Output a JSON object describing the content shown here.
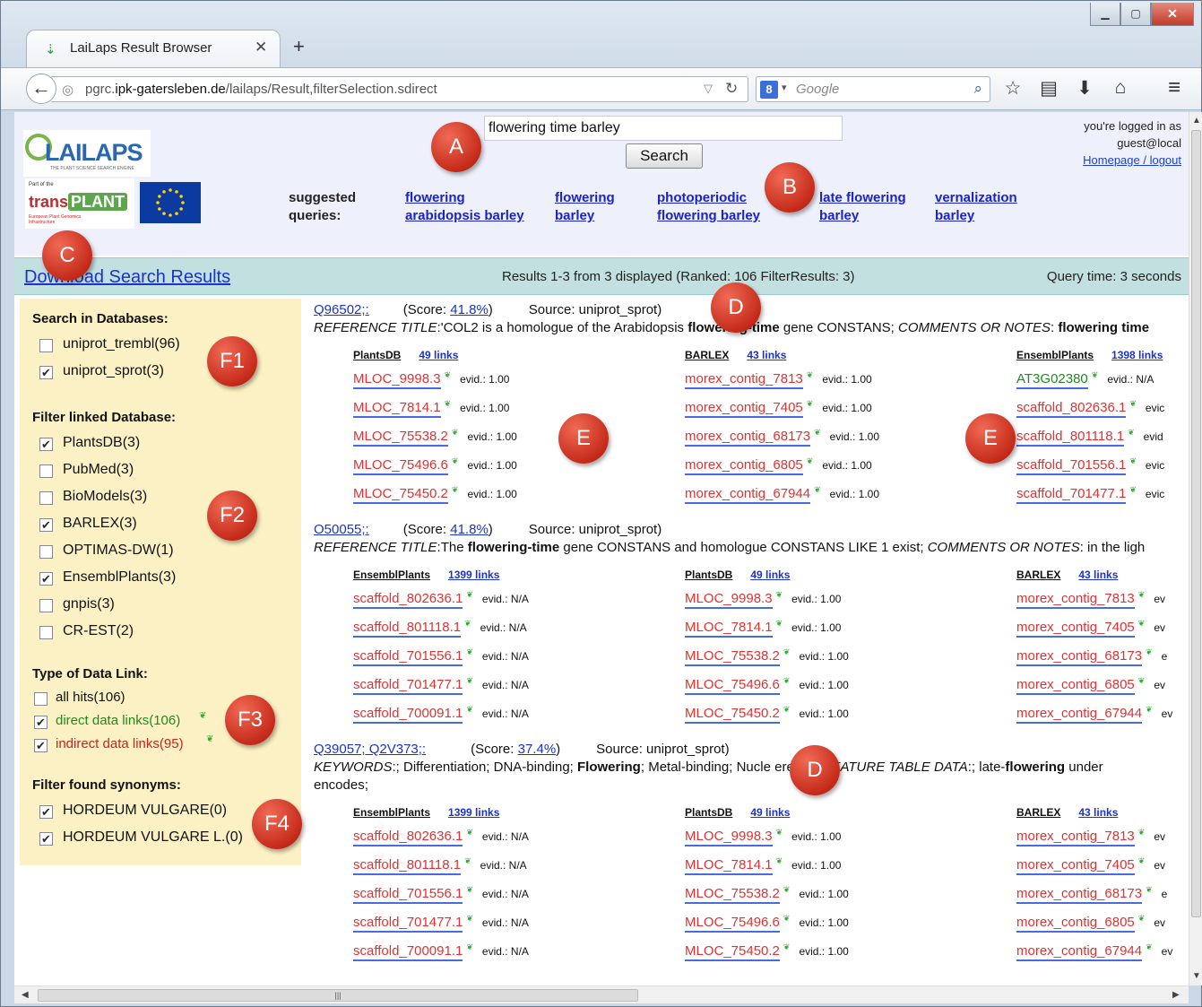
{
  "browser": {
    "tab_title": "LaiLaps Result Browser",
    "url_host_prefix": "pgrc.",
    "url_host": "ipk-gatersleben.de",
    "url_path": "/lailaps/Result,filterSelection.sdirect",
    "search_engine_placeholder": "Google"
  },
  "header": {
    "search_value": "flowering time barley",
    "search_button": "Search",
    "login_line1": "you're logged in as",
    "login_line2": "guest@local",
    "login_link": "Homepage / logout",
    "suggested_label_1": "suggested",
    "suggested_label_2": "queries:",
    "suggestions": [
      [
        "flowering",
        "arabidopsis barley"
      ],
      [
        "flowering",
        "barley"
      ],
      [
        "photoperiodic",
        "flowering barley"
      ],
      [
        "late flowering",
        "barley"
      ],
      [
        "vernalization",
        "barley"
      ]
    ]
  },
  "results_bar": {
    "download": "Download Search Results",
    "info": "Results 1-3 from 3 displayed (Ranked: 106 FilterResults: 3)",
    "query_time": "Query time: 3 seconds"
  },
  "filters": {
    "search_db_title": "Search in Databases:",
    "search_db": [
      {
        "label": "uniprot_trembl(96)",
        "checked": false
      },
      {
        "label": "uniprot_sprot(3)",
        "checked": true
      }
    ],
    "linked_db_title": "Filter linked Database:",
    "linked_db": [
      {
        "label": "PlantsDB(3)",
        "checked": true
      },
      {
        "label": "PubMed(3)",
        "checked": false
      },
      {
        "label": "BioModels(3)",
        "checked": false
      },
      {
        "label": "BARLEX(3)",
        "checked": true
      },
      {
        "label": "OPTIMAS-DW(1)",
        "checked": false
      },
      {
        "label": "EnsemblPlants(3)",
        "checked": true
      },
      {
        "label": "gnpis(3)",
        "checked": false
      },
      {
        "label": "CR-EST(2)",
        "checked": false
      }
    ],
    "link_type_title": "Type of Data Link:",
    "link_type": [
      {
        "label": "all hits(106)",
        "checked": false
      },
      {
        "label": "direct data links(106)",
        "checked": true
      },
      {
        "label": "indirect data links(95)",
        "checked": true
      }
    ],
    "synonyms_title": "Filter found synonyms:",
    "synonyms": [
      {
        "label": "HORDEUM VULGARE(0)",
        "checked": true
      },
      {
        "label": "HORDEUM VULGARE L.(0)",
        "checked": true
      }
    ]
  },
  "results": [
    {
      "id": "Q96502;:",
      "score_label": "(Score:",
      "score": "41.8%",
      "score_close": ")",
      "source": "Source: uniprot_sprot)",
      "desc_parts": [
        [
          "i",
          "REFERENCE TITLE"
        ],
        [
          "t",
          ":'COL2 is a homologue of the Arabidopsis "
        ],
        [
          "b",
          "flowering-time"
        ],
        [
          "t",
          " gene CONSTANS; "
        ],
        [
          "i",
          "COMMENTS OR NOTES"
        ],
        [
          "t",
          ": "
        ],
        [
          "b",
          "flowering time"
        ]
      ],
      "desc2": "",
      "columns": [
        {
          "db": "PlantsDB",
          "links": "49 links",
          "items": [
            [
              "MLOC_9998.3",
              "evid.: 1.00"
            ],
            [
              "MLOC_7814.1",
              "evid.: 1.00"
            ],
            [
              "MLOC_75538.2",
              "evid.: 1.00"
            ],
            [
              "MLOC_75496.6",
              "evid.: 1.00"
            ],
            [
              "MLOC_75450.2",
              "evid.: 1.00"
            ]
          ]
        },
        {
          "db": "BARLEX",
          "links": "43 links",
          "items": [
            [
              "morex_contig_7813",
              "evid.: 1.00"
            ],
            [
              "morex_contig_7405",
              "evid.: 1.00"
            ],
            [
              "morex_contig_68173",
              "evid.: 1.00"
            ],
            [
              "morex_contig_6805",
              "evid.: 1.00"
            ],
            [
              "morex_contig_67944",
              "evid.: 1.00"
            ]
          ]
        },
        {
          "db": "EnsemblPlants",
          "links": "1398 links",
          "items": [
            [
              "AT3G02380",
              "evid.: N/A"
            ],
            [
              "scaffold_802636.1",
              "evic"
            ],
            [
              "scaffold_801118.1",
              "evid"
            ],
            [
              "scaffold_701556.1",
              "evic"
            ],
            [
              "scaffold_701477.1",
              "evic"
            ]
          ]
        }
      ]
    },
    {
      "id": "O50055;:",
      "score_label": "(Score:",
      "score": "41.8%",
      "score_close": ")",
      "source": "Source: uniprot_sprot)",
      "desc_parts": [
        [
          "i",
          "REFERENCE TITLE"
        ],
        [
          "t",
          ":The "
        ],
        [
          "b",
          "flowering-time"
        ],
        [
          "t",
          " gene CONSTANS and homologue CONSTANS LIKE 1 exist; "
        ],
        [
          "i",
          "COMMENTS OR NOTES"
        ],
        [
          "t",
          ": in the ligh"
        ]
      ],
      "desc2": "",
      "columns": [
        {
          "db": "EnsemblPlants",
          "links": "1399 links",
          "items": [
            [
              "scaffold_802636.1",
              "evid.: N/A"
            ],
            [
              "scaffold_801118.1",
              "evid.: N/A"
            ],
            [
              "scaffold_701556.1",
              "evid.: N/A"
            ],
            [
              "scaffold_701477.1",
              "evid.: N/A"
            ],
            [
              "scaffold_700091.1",
              "evid.: N/A"
            ]
          ]
        },
        {
          "db": "PlantsDB",
          "links": "49 links",
          "items": [
            [
              "MLOC_9998.3",
              "evid.: 1.00"
            ],
            [
              "MLOC_7814.1",
              "evid.: 1.00"
            ],
            [
              "MLOC_75538.2",
              "evid.: 1.00"
            ],
            [
              "MLOC_75496.6",
              "evid.: 1.00"
            ],
            [
              "MLOC_75450.2",
              "evid.: 1.00"
            ]
          ]
        },
        {
          "db": "BARLEX",
          "links": "43 links",
          "items": [
            [
              "morex_contig_7813",
              "ev"
            ],
            [
              "morex_contig_7405",
              "ev"
            ],
            [
              "morex_contig_68173",
              "e"
            ],
            [
              "morex_contig_6805",
              "ev"
            ],
            [
              "morex_contig_67944",
              "ev"
            ]
          ]
        }
      ]
    },
    {
      "id": "Q39057; Q2V373;:",
      "score_label": "(Score:",
      "score": "37.4%",
      "score_close": ")",
      "source": "Source: uniprot_sprot)",
      "desc_parts": [
        [
          "i",
          "KEYWORDS"
        ],
        [
          "t",
          ":; Differentiation; DNA-binding; "
        ],
        [
          "b",
          "Flowering"
        ],
        [
          "t",
          "; Metal-binding; Nucle"
        ],
        [
          "t",
          "                  erence; "
        ],
        [
          "i",
          "FEATURE TABLE DATA"
        ],
        [
          "t",
          ":; late-"
        ],
        [
          "b",
          "flowering"
        ],
        [
          "t",
          " under"
        ]
      ],
      "desc2": "encodes;",
      "columns": [
        {
          "db": "EnsemblPlants",
          "links": "1399 links",
          "items": [
            [
              "scaffold_802636.1",
              "evid.: N/A"
            ],
            [
              "scaffold_801118.1",
              "evid.: N/A"
            ],
            [
              "scaffold_701556.1",
              "evid.: N/A"
            ],
            [
              "scaffold_701477.1",
              "evid.: N/A"
            ],
            [
              "scaffold_700091.1",
              "evid.: N/A"
            ]
          ]
        },
        {
          "db": "PlantsDB",
          "links": "49 links",
          "items": [
            [
              "MLOC_9998.3",
              "evid.: 1.00"
            ],
            [
              "MLOC_7814.1",
              "evid.: 1.00"
            ],
            [
              "MLOC_75538.2",
              "evid.: 1.00"
            ],
            [
              "MLOC_75496.6",
              "evid.: 1.00"
            ],
            [
              "MLOC_75450.2",
              "evid.: 1.00"
            ]
          ]
        },
        {
          "db": "BARLEX",
          "links": "43 links",
          "items": [
            [
              "morex_contig_7813",
              "ev"
            ],
            [
              "morex_contig_7405",
              "ev"
            ],
            [
              "morex_contig_68173",
              "e"
            ],
            [
              "morex_contig_6805",
              "ev"
            ],
            [
              "morex_contig_67944",
              "ev"
            ]
          ]
        }
      ]
    }
  ],
  "markers": [
    "A",
    "B",
    "C",
    "D",
    "D",
    "E",
    "E",
    "F1",
    "F2",
    "F3",
    "F4"
  ],
  "colors": {
    "header_bg": "#eef0fb",
    "results_bar": "#c3e0e0",
    "filter_panel": "#fcf1c4",
    "marker": "#c62b1a",
    "link": "#1a33cc",
    "accession": "#d33"
  }
}
